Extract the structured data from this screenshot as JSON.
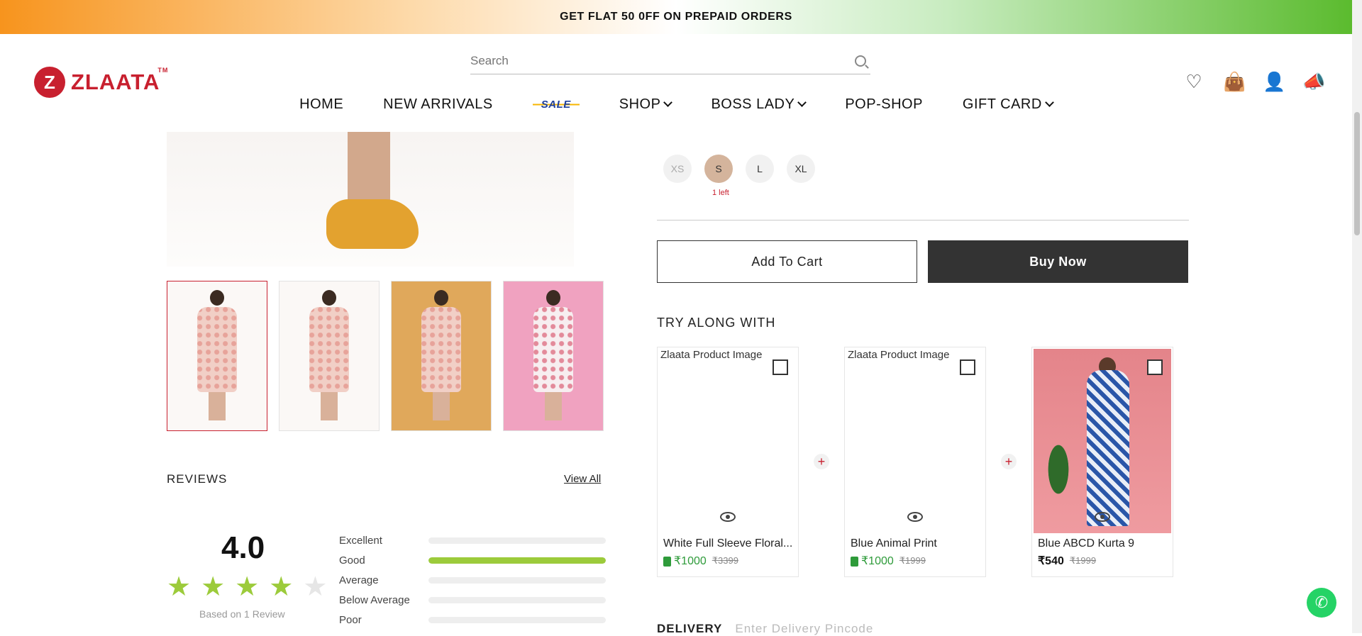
{
  "promo": {
    "text": "GET FLAT 50 0FF ON PREPAID ORDERS"
  },
  "header": {
    "logo_text": "ZLAATA",
    "logo_tm": "TM",
    "search_placeholder": "Search",
    "nav": [
      {
        "label": "HOME"
      },
      {
        "label": "NEW ARRIVALS"
      },
      {
        "label": "SALE"
      },
      {
        "label": "SHOP"
      },
      {
        "label": "BOSS LADY"
      },
      {
        "label": "POP-SHOP"
      },
      {
        "label": "GIFT CARD"
      }
    ],
    "icons": [
      "heart-icon",
      "bag-icon",
      "user-icon",
      "megaphone-icon"
    ]
  },
  "product": {
    "sizes": [
      {
        "label": "XS",
        "state": "disabled"
      },
      {
        "label": "S",
        "state": "selected"
      },
      {
        "label": "L",
        "state": "available"
      },
      {
        "label": "XL",
        "state": "available"
      }
    ],
    "stock_note": "1 left",
    "add_to_cart": "Add To Cart",
    "buy_now": "Buy Now"
  },
  "try_along": {
    "title": "TRY ALONG WITH",
    "items": [
      {
        "image_alt": "Zlaata Product Image",
        "name": "White Full Sleeve Floral...",
        "price": "₹1000",
        "mrp": "₹3399"
      },
      {
        "image_alt": "Zlaata Product Image",
        "name": "Blue Animal Print",
        "price": "₹1000",
        "mrp": "₹1999"
      },
      {
        "image_alt": "Zlaata Product Image",
        "name": "Blue ABCD Kurta 9",
        "price": "₹540",
        "mrp": "₹1999"
      }
    ]
  },
  "reviews": {
    "title": "REVIEWS",
    "view_all": "View All",
    "average": "4.0",
    "stars_filled": 4,
    "stars_total": 5,
    "based_on": "Based on 1 Review",
    "breakdown": [
      {
        "label": "Excellent",
        "fraction": 0
      },
      {
        "label": "Good",
        "fraction": 1
      },
      {
        "label": "Average",
        "fraction": 0
      },
      {
        "label": "Below Average",
        "fraction": 0
      },
      {
        "label": "Poor",
        "fraction": 0
      }
    ]
  },
  "delivery": {
    "title": "DELIVERY",
    "placeholder": "Enter Delivery Pincode"
  },
  "colors": {
    "brand": "#c8202f",
    "accent_green": "#9ccb3b",
    "dark_button": "#333333"
  }
}
